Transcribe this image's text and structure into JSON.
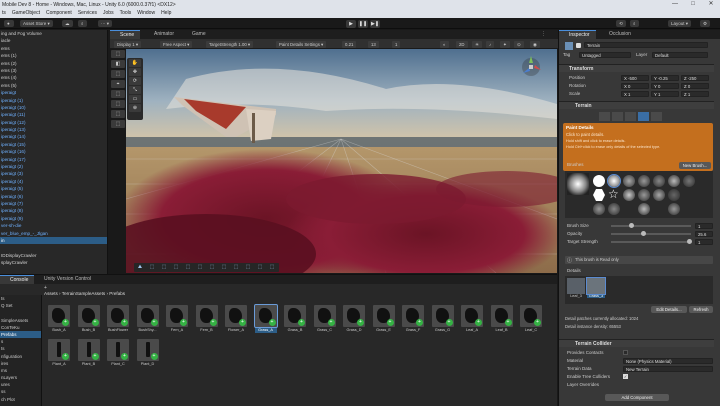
{
  "window": {
    "title": "Mobile Dev 8 - Home - Windows, Mac, Linux - Unity 6.0 (6000.0.37f1) <DX12>",
    "controls": [
      "—",
      "□",
      "✕"
    ]
  },
  "menu": [
    "ts",
    "GameObject",
    "Component",
    "Services",
    "Jobs",
    "Tools",
    "Window",
    "Help"
  ],
  "toolbar": {
    "account": "Asset Store ▾",
    "play": "▶",
    "pause": "❚❚",
    "step": "▶❚",
    "layout": "Layout ▾"
  },
  "hierarchy": {
    "rows": [
      {
        "label": "ing and Fog Volume",
        "style": "normal"
      },
      {
        "label": "iacle",
        "style": "normal"
      },
      {
        "label": "ems",
        "style": "normal"
      },
      {
        "label": "ems (1)",
        "style": "normal"
      },
      {
        "label": "ems (2)",
        "style": "normal"
      },
      {
        "label": "ems (3)",
        "style": "normal"
      },
      {
        "label": "ems (4)",
        "style": "normal"
      },
      {
        "label": "ems (5)",
        "style": "normal"
      },
      {
        "label": "iperaigt",
        "style": "blue"
      },
      {
        "label": "iperaigt (1)",
        "style": "blue"
      },
      {
        "label": "iperaigt (10)",
        "style": "blue"
      },
      {
        "label": "iperaigt (11)",
        "style": "blue"
      },
      {
        "label": "iperaigt (12)",
        "style": "blue"
      },
      {
        "label": "iperaigt (13)",
        "style": "blue"
      },
      {
        "label": "iperaigt (14)",
        "style": "blue"
      },
      {
        "label": "iperaigt (15)",
        "style": "blue"
      },
      {
        "label": "iperaigt (16)",
        "style": "blue"
      },
      {
        "label": "iperaigt (17)",
        "style": "blue"
      },
      {
        "label": "iperaigt (2)",
        "style": "blue"
      },
      {
        "label": "iperaigt (3)",
        "style": "blue"
      },
      {
        "label": "iperaigt (4)",
        "style": "blue"
      },
      {
        "label": "iperaigt (5)",
        "style": "blue"
      },
      {
        "label": "iperaigt (6)",
        "style": "blue"
      },
      {
        "label": "iperaigt (7)",
        "style": "blue"
      },
      {
        "label": "iperaigt (8)",
        "style": "blue"
      },
      {
        "label": "iperaigt (9)",
        "style": "blue"
      },
      {
        "label": "ver-sh-die",
        "style": "blue"
      },
      {
        "label": "ver_blue_emp_-_Jlgan",
        "style": "blue"
      },
      {
        "label": "in",
        "style": "sel"
      },
      {
        "label": "",
        "style": "normal"
      },
      {
        "label": "IDDisplayCrawler",
        "style": "normal"
      },
      {
        "label": "splayCrawler",
        "style": "normal"
      }
    ]
  },
  "scene": {
    "tabs": [
      "Scene",
      "Animator",
      "Game"
    ],
    "toolbar": {
      "display": "Display 1 ▾",
      "aspect": "Free Aspect ▾",
      "scale_label": "Scale",
      "scale_value": "1x",
      "render": "TargetStrength 1.00 ▾",
      "shading": "Paint Details Settings ▾",
      "brush_size": "0.21",
      "field2": "13",
      "field3": "1"
    },
    "tools": [
      "✋",
      "✥",
      "⟳",
      "⤡",
      "▭",
      "⊕"
    ],
    "left_tools": [
      "⬚",
      "◧",
      "⬚",
      "⌖",
      "⬚",
      "⬚",
      "⬚",
      "⬚"
    ],
    "overlay_icons": [
      "⛰",
      "⬚",
      "⬚",
      "⬚",
      "⬚",
      "⬚",
      "⬚",
      "⬚",
      "⬚",
      "⬚",
      "⬚",
      "⬚"
    ],
    "persp": "Persp"
  },
  "inspector": {
    "tabs": [
      "Inspector",
      "Occlusion"
    ],
    "object_name": "Terrain",
    "tag_label": "Tag",
    "tag_value": "Untagged",
    "layer_label": "Layer",
    "layer_value": "Default",
    "transform": {
      "header": "Transform",
      "position_label": "Position",
      "scale_label": "Scale",
      "rotation_label": "Rotation",
      "pos": [
        "X -500",
        "Y -0.25",
        "Z -250"
      ],
      "rot": [
        "X 0",
        "Y 0",
        "Z 0"
      ],
      "scl": [
        "X 1",
        "Y 1",
        "Z 1"
      ]
    },
    "terrain": {
      "header": "Terrain",
      "paint_details": "Paint Details",
      "desc": "Click to paint details.",
      "hint1": "Hold shift and click to erase details.",
      "hint2": "Hold Ctrl+click to erase only details of the selected type.",
      "brushes_label": "Brushes",
      "new_brush": "New Brush...",
      "brush_size_label": "Brush Size",
      "brush_size_value": "1",
      "opacity_label": "Opacity",
      "opacity_value": "25.6",
      "target_strength_label": "Target Strength",
      "target_strength_value": "1",
      "preview_note": "This brush is Read only",
      "details_label": "Details",
      "detail_thumbs": [
        "Leaf_3",
        "Grass_3"
      ],
      "edit_details": "Edit Details...",
      "refresh": "Refresh",
      "patches_note": "Detail patches currently allocated: 1024",
      "instance_note": "Detail instance density: 65553"
    },
    "collider": {
      "header": "Terrain Collider",
      "provides_contacts_label": "Provides Contacts",
      "material_label": "Material",
      "material_value": "None (Physics Material)",
      "terrain_data_label": "Terrain Data",
      "terrain_data_value": "New Terrain",
      "enable_tree_label": "Enable Tree Colliders",
      "layer_overrides_label": "Layer Overrides"
    },
    "add_component": "Add Component"
  },
  "bottom": {
    "tabs": [
      "Console",
      "Unity Version Control"
    ],
    "breadcrumb": "Assets › TerrainSampleAssets › Prefabs",
    "tree": [
      {
        "label": "ts",
        "sel": false
      },
      {
        "label": "Q Set",
        "sel": false
      },
      {
        "label": "",
        "sel": false
      },
      {
        "label": "SimpleAssets",
        "sel": false
      },
      {
        "label": "ConTeKu",
        "sel": false
      },
      {
        "label": "Prefabs",
        "sel": true
      },
      {
        "label": "s",
        "sel": false
      },
      {
        "label": "ts",
        "sel": false
      },
      {
        "label": "nfiguration",
        "sel": false
      },
      {
        "label": "ires",
        "sel": false
      },
      {
        "label": "ms",
        "sel": false
      },
      {
        "label": "nLayers",
        "sel": false
      },
      {
        "label": "ures",
        "sel": false
      },
      {
        "label": "ss",
        "sel": false
      },
      {
        "label": "ch Plot",
        "sel": false
      }
    ],
    "assets": [
      "Bush_A",
      "Bush_B",
      "BushFlower",
      "BushShy...",
      "Fern_A",
      "Fern_B",
      "Flower_A",
      "Grass_A",
      "Grass_B",
      "Grass_C",
      "Grass_D",
      "Grass_E",
      "Grass_F",
      "Grass_G",
      "Leaf_A",
      "Leaf_B",
      "Leaf_C",
      "Plant_A",
      "Plant_B",
      "Plant_C",
      "Plant_D"
    ],
    "selected_asset": 7
  }
}
